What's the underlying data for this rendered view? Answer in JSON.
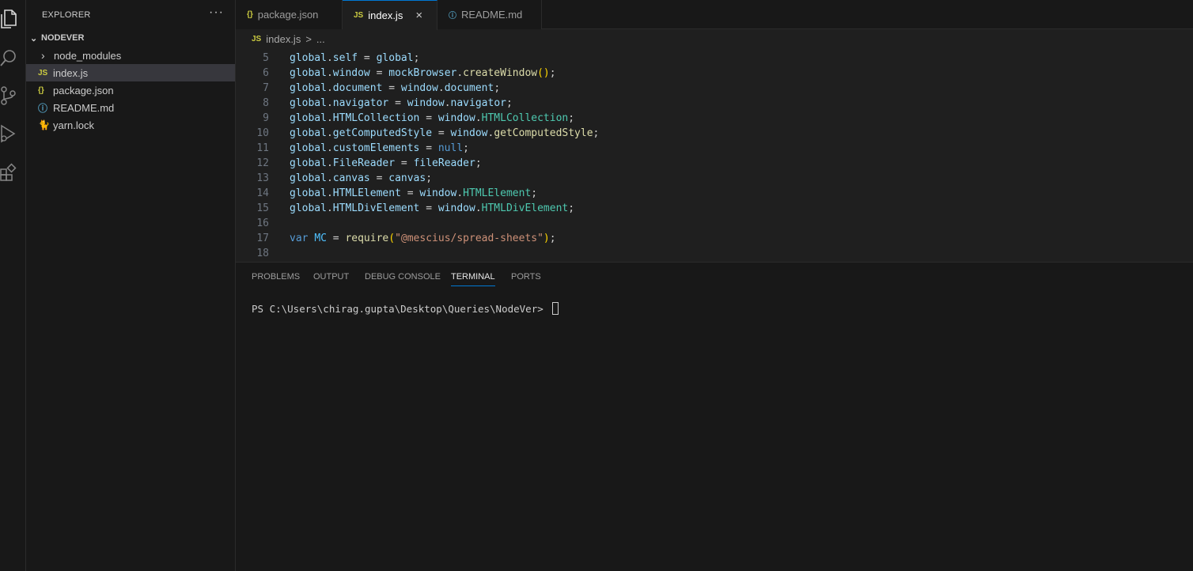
{
  "sidebar": {
    "title": "EXPLORER",
    "more": "···",
    "folder": "NODEVER",
    "items": [
      {
        "icon": "›",
        "label": "node_modules",
        "kind": "folder",
        "color": "#cccccc"
      },
      {
        "icon": "JS",
        "label": "index.js",
        "kind": "js",
        "color": "#cbcb41",
        "selected": true
      },
      {
        "icon": "{}",
        "label": "package.json",
        "kind": "json",
        "color": "#cbcb41"
      },
      {
        "icon": "ⓘ",
        "label": "README.md",
        "kind": "info",
        "color": "#519aba"
      },
      {
        "icon": "🐈",
        "label": "yarn.lock",
        "kind": "yarn",
        "color": "#519aba"
      }
    ]
  },
  "tabs": [
    {
      "icon": "{}",
      "label": "package.json",
      "icon_color": "#cbcb41"
    },
    {
      "icon": "JS",
      "label": "index.js",
      "icon_color": "#cbcb41",
      "active": true,
      "close": "×"
    },
    {
      "icon": "ⓘ",
      "label": "README.md",
      "icon_color": "#519aba"
    }
  ],
  "breadcrumb": {
    "icon": "JS",
    "file": "index.js",
    "sep": ">",
    "more": "..."
  },
  "code": {
    "lines": [
      {
        "n": "5",
        "tokens": [
          [
            "global",
            "t-var"
          ],
          [
            ".",
            "t-plain"
          ],
          [
            "self",
            "t-var"
          ],
          [
            " = ",
            "t-plain"
          ],
          [
            "global",
            "t-var"
          ],
          [
            ";",
            "t-plain"
          ]
        ]
      },
      {
        "n": "6",
        "tokens": [
          [
            "global",
            "t-var"
          ],
          [
            ".",
            "t-plain"
          ],
          [
            "window",
            "t-var"
          ],
          [
            " = ",
            "t-plain"
          ],
          [
            "mockBrowser",
            "t-var"
          ],
          [
            ".",
            "t-plain"
          ],
          [
            "createWindow",
            "t-fn"
          ],
          [
            "()",
            "t-paren"
          ],
          [
            ";",
            "t-plain"
          ]
        ]
      },
      {
        "n": "7",
        "tokens": [
          [
            "global",
            "t-var"
          ],
          [
            ".",
            "t-plain"
          ],
          [
            "document",
            "t-var"
          ],
          [
            " = ",
            "t-plain"
          ],
          [
            "window",
            "t-var"
          ],
          [
            ".",
            "t-plain"
          ],
          [
            "document",
            "t-var"
          ],
          [
            ";",
            "t-plain"
          ]
        ]
      },
      {
        "n": "8",
        "tokens": [
          [
            "global",
            "t-var"
          ],
          [
            ".",
            "t-plain"
          ],
          [
            "navigator",
            "t-var"
          ],
          [
            " = ",
            "t-plain"
          ],
          [
            "window",
            "t-var"
          ],
          [
            ".",
            "t-plain"
          ],
          [
            "navigator",
            "t-var"
          ],
          [
            ";",
            "t-plain"
          ]
        ]
      },
      {
        "n": "9",
        "tokens": [
          [
            "global",
            "t-var"
          ],
          [
            ".",
            "t-plain"
          ],
          [
            "HTMLCollection",
            "t-var"
          ],
          [
            " = ",
            "t-plain"
          ],
          [
            "window",
            "t-var"
          ],
          [
            ".",
            "t-plain"
          ],
          [
            "HTMLCollection",
            "t-type"
          ],
          [
            ";",
            "t-plain"
          ]
        ]
      },
      {
        "n": "10",
        "tokens": [
          [
            "global",
            "t-var"
          ],
          [
            ".",
            "t-plain"
          ],
          [
            "getComputedStyle",
            "t-var"
          ],
          [
            " = ",
            "t-plain"
          ],
          [
            "window",
            "t-var"
          ],
          [
            ".",
            "t-plain"
          ],
          [
            "getComputedStyle",
            "t-fn"
          ],
          [
            ";",
            "t-plain"
          ]
        ]
      },
      {
        "n": "11",
        "tokens": [
          [
            "global",
            "t-var"
          ],
          [
            ".",
            "t-plain"
          ],
          [
            "customElements",
            "t-var"
          ],
          [
            " = ",
            "t-plain"
          ],
          [
            "null",
            "t-kw"
          ],
          [
            ";",
            "t-plain"
          ]
        ]
      },
      {
        "n": "12",
        "tokens": [
          [
            "global",
            "t-var"
          ],
          [
            ".",
            "t-plain"
          ],
          [
            "FileReader",
            "t-var"
          ],
          [
            " = ",
            "t-plain"
          ],
          [
            "fileReader",
            "t-var"
          ],
          [
            ";",
            "t-plain"
          ]
        ]
      },
      {
        "n": "13",
        "tokens": [
          [
            "global",
            "t-var"
          ],
          [
            ".",
            "t-plain"
          ],
          [
            "canvas",
            "t-var"
          ],
          [
            " = ",
            "t-plain"
          ],
          [
            "canvas",
            "t-var"
          ],
          [
            ";",
            "t-plain"
          ]
        ]
      },
      {
        "n": "14",
        "tokens": [
          [
            "global",
            "t-var"
          ],
          [
            ".",
            "t-plain"
          ],
          [
            "HTMLElement",
            "t-var"
          ],
          [
            " = ",
            "t-plain"
          ],
          [
            "window",
            "t-var"
          ],
          [
            ".",
            "t-plain"
          ],
          [
            "HTMLElement",
            "t-type"
          ],
          [
            ";",
            "t-plain"
          ]
        ]
      },
      {
        "n": "15",
        "tokens": [
          [
            "global",
            "t-var"
          ],
          [
            ".",
            "t-plain"
          ],
          [
            "HTMLDivElement",
            "t-var"
          ],
          [
            " = ",
            "t-plain"
          ],
          [
            "window",
            "t-var"
          ],
          [
            ".",
            "t-plain"
          ],
          [
            "HTMLDivElement",
            "t-type"
          ],
          [
            ";",
            "t-plain"
          ]
        ]
      },
      {
        "n": "16",
        "tokens": []
      },
      {
        "n": "17",
        "tokens": [
          [
            "var",
            "t-kw"
          ],
          [
            " ",
            "t-plain"
          ],
          [
            "MC",
            "t-const"
          ],
          [
            " = ",
            "t-plain"
          ],
          [
            "require",
            "t-fn"
          ],
          [
            "(",
            "t-paren"
          ],
          [
            "\"@mescius/spread-sheets\"",
            "t-str"
          ],
          [
            ")",
            "t-paren"
          ],
          [
            ";",
            "t-plain"
          ]
        ]
      },
      {
        "n": "18",
        "tokens": []
      }
    ]
  },
  "panel": {
    "tabs": [
      "PROBLEMS",
      "OUTPUT",
      "DEBUG CONSOLE",
      "TERMINAL",
      "PORTS"
    ],
    "active_tab": "TERMINAL",
    "terminal_prompt": "PS C:\\Users\\chirag.gupta\\Desktop\\Queries\\NodeVer> "
  },
  "activity_icons": [
    "explorer-icon",
    "search-icon",
    "source-control-icon",
    "run-debug-icon",
    "extensions-icon"
  ]
}
